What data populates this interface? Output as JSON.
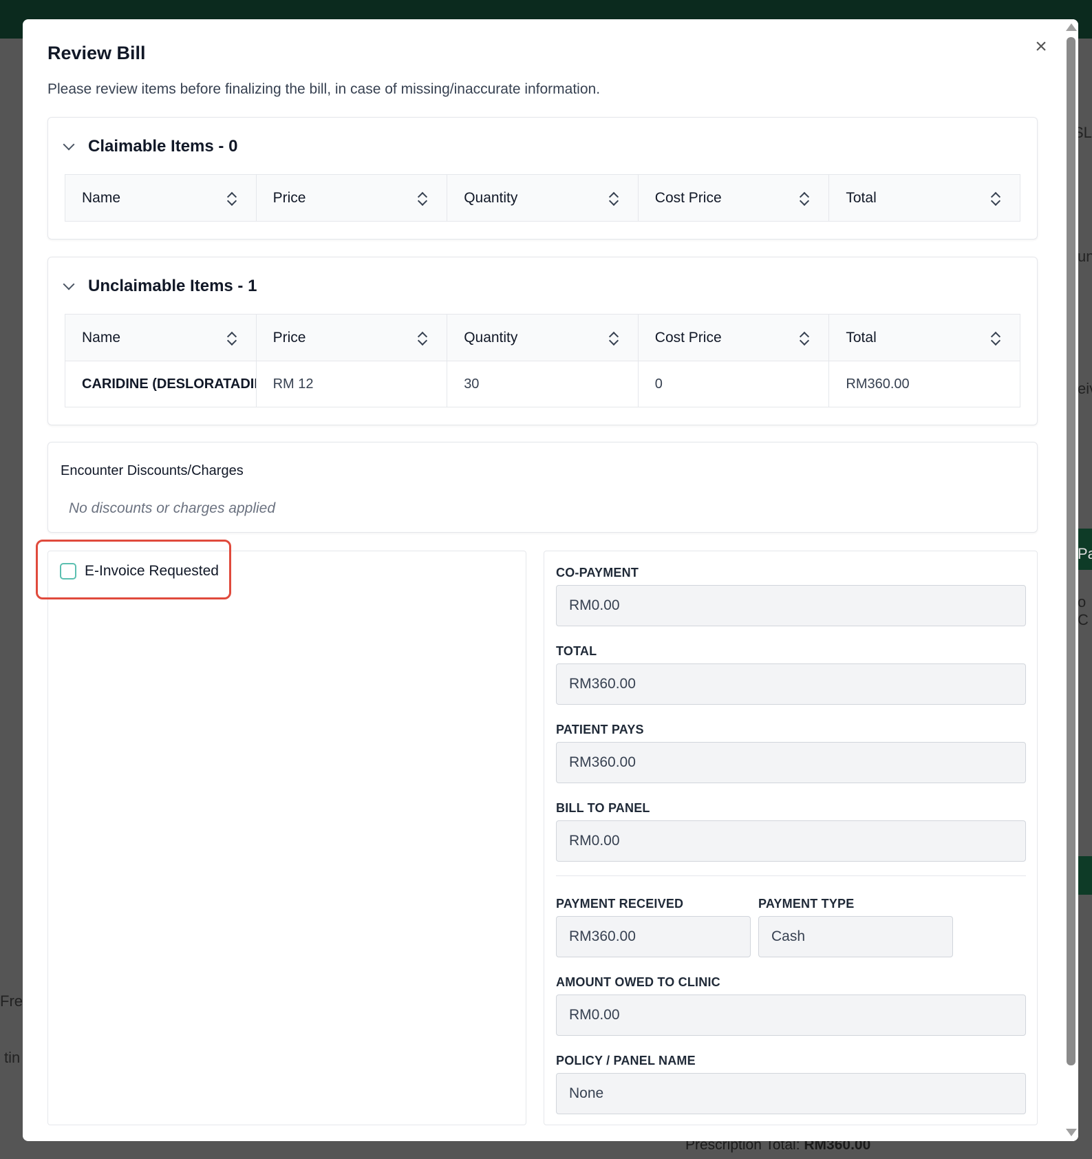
{
  "background": {
    "fragments": [
      "SLO",
      "un",
      "eiv",
      "Pay",
      "o C",
      "Freq",
      "tin"
    ],
    "footer_label": "Prescription Total:",
    "footer_value": "RM360.00"
  },
  "modal": {
    "title": "Review Bill",
    "description": "Please review items before finalizing the bill, in case of missing/inaccurate information.",
    "close_icon": "×"
  },
  "table_headers": [
    "Name",
    "Price",
    "Quantity",
    "Cost Price",
    "Total"
  ],
  "claimable": {
    "title": "Claimable Items - 0",
    "rows": []
  },
  "unclaimable": {
    "title": "Unclaimable Items - 1",
    "rows": [
      {
        "name": "CARIDINE (DESLORATADINE)",
        "price": "RM 12",
        "quantity": "30",
        "cost_price": "0",
        "total": "RM360.00"
      }
    ]
  },
  "discounts": {
    "title": "Encounter Discounts/Charges",
    "empty_text": "No discounts or charges applied"
  },
  "einvoice": {
    "label": "E-Invoice Requested",
    "checked": false
  },
  "summary": {
    "co_payment_label": "CO-PAYMENT",
    "co_payment_value": "RM0.00",
    "total_label": "TOTAL",
    "total_value": "RM360.00",
    "patient_pays_label": "PATIENT PAYS",
    "patient_pays_value": "RM360.00",
    "bill_to_panel_label": "BILL TO PANEL",
    "bill_to_panel_value": "RM0.00",
    "payment_received_label": "PAYMENT RECEIVED",
    "payment_received_value": "RM360.00",
    "payment_type_label": "PAYMENT TYPE",
    "payment_type_value": "Cash",
    "amount_owed_label": "AMOUNT OWED TO CLINIC",
    "amount_owed_value": "RM0.00",
    "policy_label": "POLICY / PANEL NAME",
    "policy_value": "None"
  },
  "colors": {
    "checkbox_border": "#5bbfb0",
    "highlight": "#e04a3c",
    "topbar": "#0b2a1e"
  }
}
